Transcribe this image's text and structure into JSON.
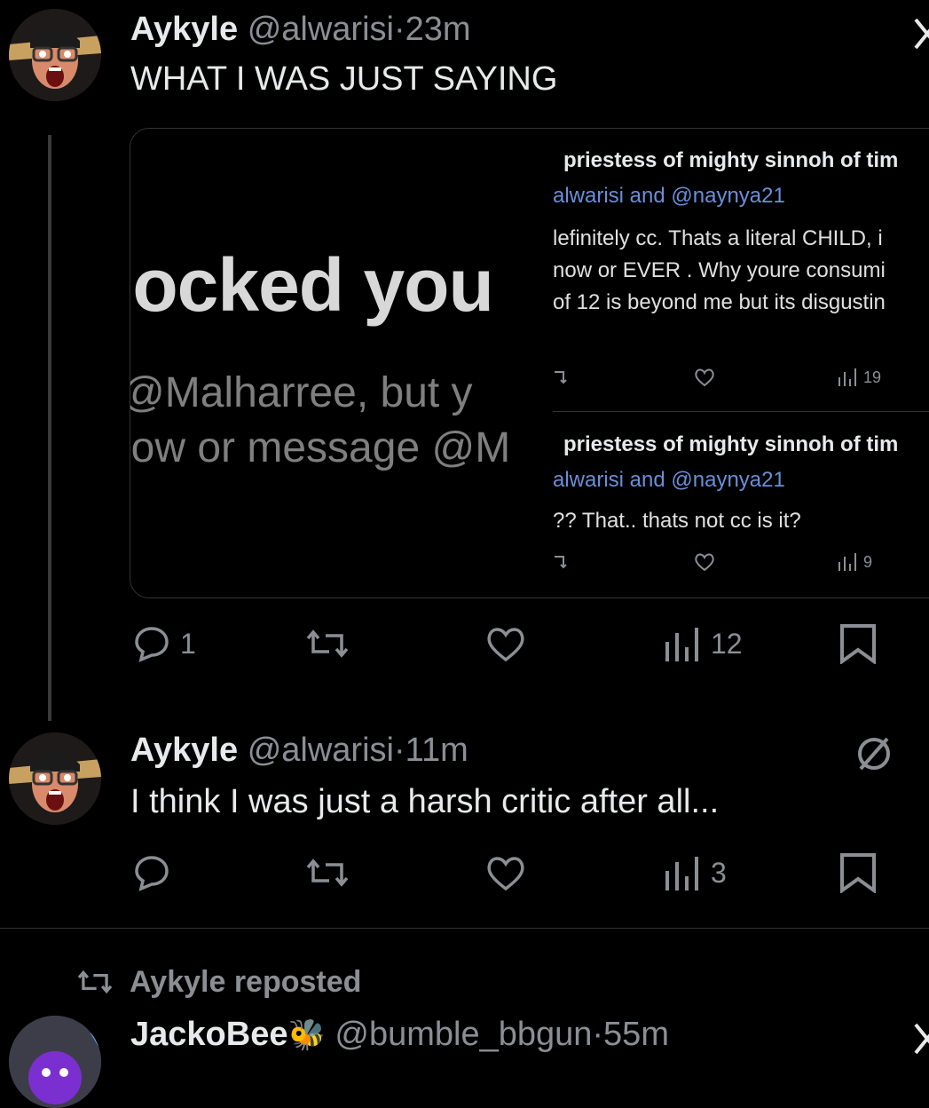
{
  "tweet1": {
    "display_name": "Aykyle",
    "handle": "@alwarisi",
    "time": "23m",
    "text": "WHAT I WAS JUST SAYING",
    "media": {
      "blocked_title": "locked you",
      "blocked_line1": " @Malharree, but y",
      "blocked_line2": "low or message @M",
      "quote1": {
        "name": "priestess of mighty sinnoh of tim",
        "reply_to": "alwarisi and @naynya21",
        "lines": [
          "lefinitely cc. Thats a literal CHILD, i",
          "now or EVER . Why youre consumi",
          "of 12 is beyond me but its disgustin"
        ],
        "views": "19"
      },
      "quote2": {
        "name": "priestess of mighty sinnoh of tim",
        "reply_to": "alwarisi and @naynya21",
        "lines": [
          "?? That.. thats not cc is it?"
        ],
        "views": "9"
      }
    },
    "stats": {
      "replies": "1",
      "views": "12"
    }
  },
  "tweet2": {
    "display_name": "Aykyle",
    "handle": "@alwarisi",
    "time": "11m",
    "text": "I think I was just a harsh critic after all...",
    "stats": {
      "views": "3"
    }
  },
  "tweet3": {
    "repost_label": "Aykyle reposted",
    "display_name": "JackoBee",
    "emoji": "🐝",
    "handle": "@bumble_bbgun",
    "time": "55m"
  },
  "icons": {
    "reply": "reply-icon",
    "repost": "repost-icon",
    "like": "heart-icon",
    "views": "views-icon",
    "bookmark": "bookmark-icon",
    "close": "close-icon",
    "not_interested": "slash-icon"
  },
  "colors": {
    "background": "#000000",
    "text": "#e7e9ea",
    "muted": "#8b8f94",
    "link": "#6a8fd8"
  }
}
